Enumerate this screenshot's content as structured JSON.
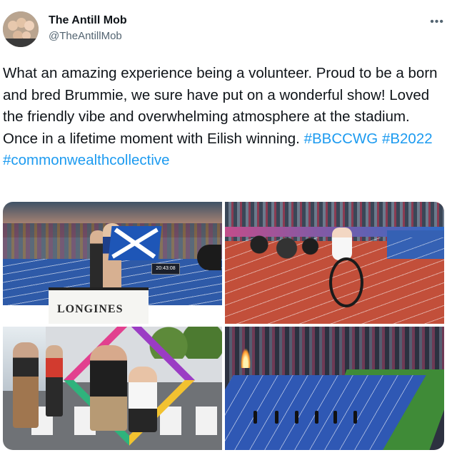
{
  "author": {
    "name": "The Antill Mob",
    "handle": "@TheAntillMob",
    "more_icon": "more-horizontal-icon"
  },
  "tweet": {
    "text": "What an amazing experience being a volunteer. Proud to be a born and bred Brummie, we sure have put on a wonderful show! Loved the friendly vibe and overwhelming atmosphere at the stadium. Once in a lifetime moment with Eilish winning.",
    "hashtags": [
      "#BBCCWG",
      "#B2022",
      "#commonwealthcollective"
    ]
  },
  "media": {
    "photo1": {
      "board_text": "LONGINES",
      "clock_text": "20:43:08"
    }
  },
  "colors": {
    "link": "#1d9bf0",
    "secondary": "#536471"
  }
}
